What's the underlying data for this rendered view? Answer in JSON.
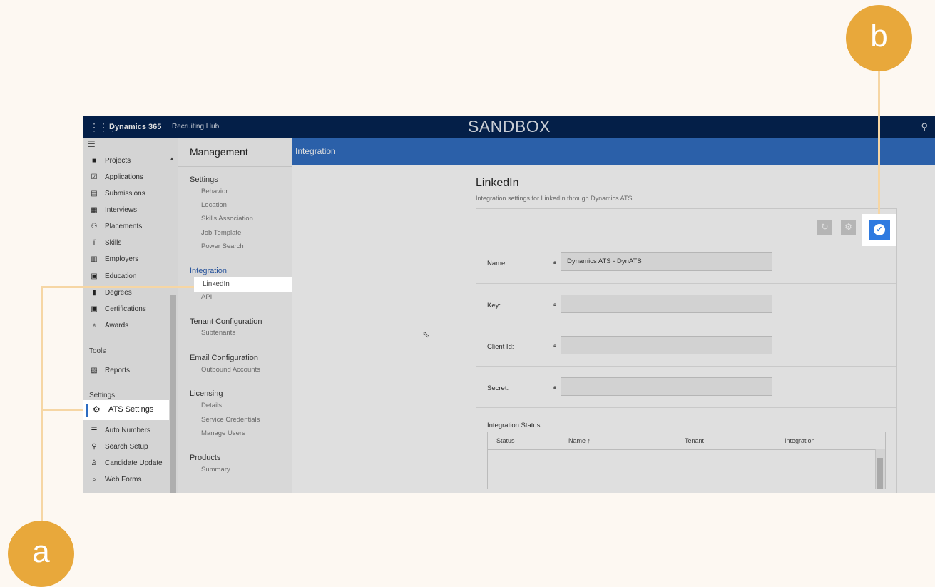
{
  "topbar": {
    "brand": "Dynamics 365",
    "module": "Recruiting Hub",
    "environment": "SANDBOX"
  },
  "sidebar": {
    "items": [
      {
        "label": "Projects",
        "icon": "briefcase-icon"
      },
      {
        "label": "Applications",
        "icon": "document-check-icon"
      },
      {
        "label": "Submissions",
        "icon": "id-card-icon"
      },
      {
        "label": "Interviews",
        "icon": "calendar-icon"
      },
      {
        "label": "Placements",
        "icon": "people-icon"
      },
      {
        "label": "Skills",
        "icon": "skills-icon"
      },
      {
        "label": "Employers",
        "icon": "building-icon"
      },
      {
        "label": "Education",
        "icon": "school-icon"
      },
      {
        "label": "Degrees",
        "icon": "book-icon"
      },
      {
        "label": "Certifications",
        "icon": "certificate-icon"
      },
      {
        "label": "Awards",
        "icon": "ribbon-icon"
      }
    ],
    "tools_heading": "Tools",
    "tools_items": [
      {
        "label": "Reports",
        "icon": "report-icon"
      }
    ],
    "settings_heading": "Settings",
    "settings_items": [
      {
        "label": "ATS Settings",
        "icon": "gear-icon"
      },
      {
        "label": "Auto Numbers",
        "icon": "numbered-list-icon"
      },
      {
        "label": "Search Setup",
        "icon": "search-setup-icon"
      },
      {
        "label": "Candidate Update",
        "icon": "person-update-icon"
      },
      {
        "label": "Web Forms",
        "icon": "web-form-icon"
      }
    ]
  },
  "management": {
    "title": "Management",
    "sections": [
      {
        "heading": "Settings",
        "items": [
          "Behavior",
          "Location",
          "Skills Association",
          "Job Template",
          "Power Search"
        ]
      },
      {
        "heading": "Integration",
        "items": [
          "LinkedIn",
          "API"
        ]
      },
      {
        "heading": "Tenant Configuration",
        "items": [
          "Subtenants"
        ]
      },
      {
        "heading": "Email Configuration",
        "items": [
          "Outbound Accounts"
        ]
      },
      {
        "heading": "Licensing",
        "items": [
          "Details",
          "Service Credentials",
          "Manage Users"
        ]
      },
      {
        "heading": "Products",
        "items": [
          "Summary"
        ]
      }
    ]
  },
  "main": {
    "header": "Integration",
    "title": "LinkedIn",
    "subtitle": "Integration settings for LinkedIn through Dynamics ATS.",
    "fields": [
      {
        "label": "Name:",
        "value": "Dynamics ATS - DynATS"
      },
      {
        "label": "Key:",
        "value": ""
      },
      {
        "label": "Client Id:",
        "value": ""
      },
      {
        "label": "Secret:",
        "value": ""
      }
    ],
    "status_label": "Integration Status:",
    "grid_columns": [
      "Status",
      "Name ↑",
      "Tenant",
      "Integration"
    ]
  },
  "annotations": {
    "a": "a",
    "b": "b"
  },
  "colors": {
    "topbar": "#002050",
    "header": "#2e6cc1",
    "accent": "#e8a83b",
    "check_button": "#2e7ae0"
  }
}
